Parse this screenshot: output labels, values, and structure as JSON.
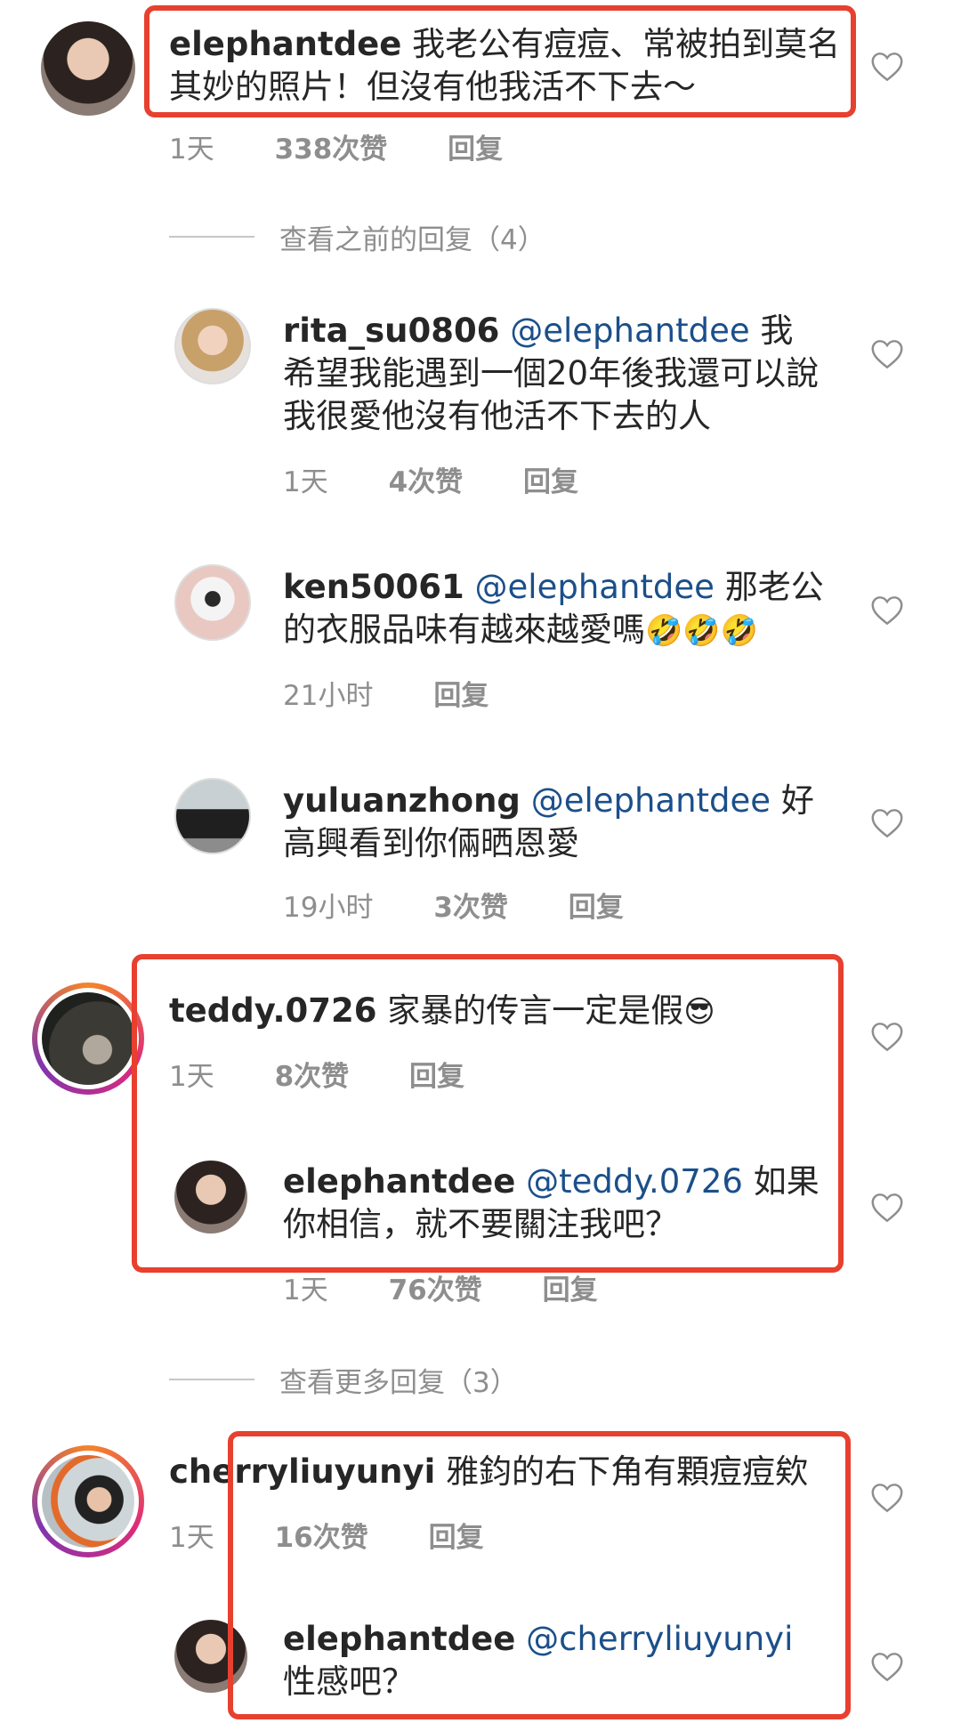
{
  "comments": [
    {
      "username": "elephantdee",
      "text": "我老公有痘痘、常被拍到莫名其妙的照片！但沒有他我活不下去～",
      "time": "1天",
      "likes": "338次赞",
      "reply": "回复"
    }
  ],
  "view_previous": "查看之前的回复（4）",
  "replies_1": [
    {
      "username": "rita_su0806",
      "mention": "@elephantdee",
      "text": "我希望我能遇到一個20年後我還可以說我很愛他沒有他活不下去的人",
      "time": "1天",
      "likes": "4次赞",
      "reply": "回复"
    },
    {
      "username": "ken50061",
      "mention": "@elephantdee",
      "text": "那老公的衣服品味有越來越愛嗎",
      "emoji": "🤣🤣🤣",
      "time": "21小时",
      "reply": "回复"
    },
    {
      "username": "yuluanzhong",
      "mention": "@elephantdee",
      "text": "好高興看到你倆晒恩愛",
      "time": "19小时",
      "likes": "3次赞",
      "reply": "回复"
    }
  ],
  "comment_2": {
    "username": "teddy.0726",
    "text": "家暴的传言一定是假",
    "emoji": "😎",
    "time": "1天",
    "likes": "8次赞",
    "reply": "回复"
  },
  "reply_2": {
    "username": "elephantdee",
    "mention": "@teddy.0726",
    "text": "如果你相信，就不要關注我吧？",
    "time": "1天",
    "likes": "76次赞",
    "reply": "回复"
  },
  "view_more": "查看更多回复（3）",
  "comment_3": {
    "username": "cherryliuyunyi",
    "text": "雅鈞的右下角有顆痘痘欸",
    "time": "1天",
    "likes": "16次赞",
    "reply": "回复"
  },
  "reply_3": {
    "username": "elephantdee",
    "mention": "@cherryliuyunyi",
    "text": "性感吧？"
  },
  "colors": {
    "highlight": "#e8402f",
    "mention": "#1b4f8a",
    "meta": "#8e8e8e",
    "story_ring": "#dd2a7b"
  }
}
